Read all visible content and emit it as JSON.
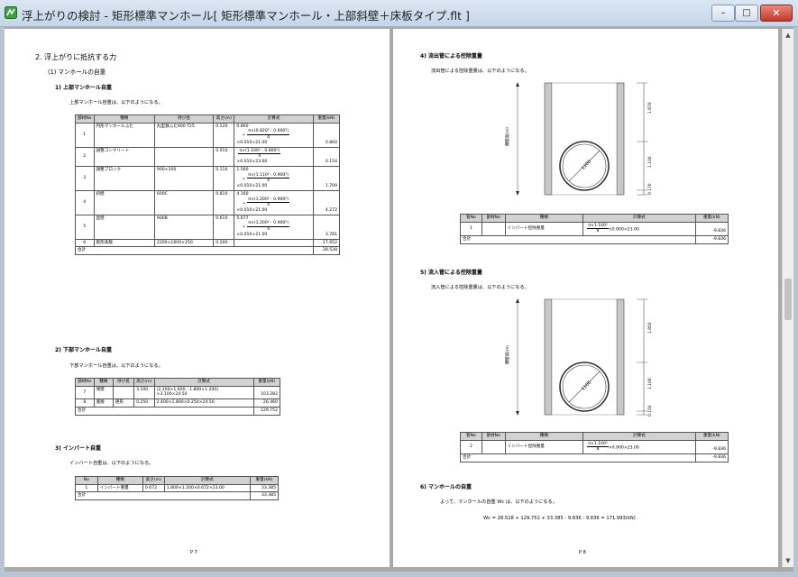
{
  "window": {
    "title": "浮上がりの検討 - 矩形標準マンホール[ 矩形標準マンホール・上部斜壁＋床板タイプ.flt ]",
    "min_label": "–",
    "max_label": "□",
    "close_label": "✕"
  },
  "left": {
    "section": "2. 浮上がりに抵抗する力",
    "sub1": "(1) マンホールの自重",
    "t1": "1) 上部マンホール自重",
    "t1_desc": "上部マンホール自重は、以下のようになる。",
    "table1": {
      "headers": [
        "部材No",
        "種類",
        "呼び名",
        "高さ(m)",
        "計算式",
        "重量(kN)"
      ],
      "rows": [
        {
          "no": "1",
          "kind": "円形マンホールふた",
          "name": "丸型鉄ふた600 T25",
          "h": "0.120",
          "l1": "0.800",
          "num": "π×(0.820² - 0.600²)",
          "den": "4",
          "l3": "×0.010×21.00",
          "w": "0.860"
        },
        {
          "no": "2",
          "kind": "調整コンクリート",
          "name": "",
          "h": "0.010",
          "l1": "",
          "num": "π×(1.100² - 0.800²)",
          "den": "4",
          "l3": "×0.010×23.00",
          "w": "0.154"
        },
        {
          "no": "3",
          "kind": "調整ブロック",
          "name": "900×100",
          "h": "0.110",
          "l1": "1.560",
          "num": "π×(1.110² - 0.900²)",
          "den": "4",
          "l3": "×0.010×21.00",
          "w": "1.709"
        },
        {
          "no": "4",
          "kind": "斜壁",
          "name": "600C",
          "h": "0.810",
          "l1": "4.160",
          "num": "π×(1.200² - 0.900²)",
          "den": "4",
          "l3": "×0.010×21.00",
          "w": "4.272"
        },
        {
          "no": "5",
          "kind": "直壁",
          "name": "900B",
          "h": "0.610",
          "l1": "5.677",
          "num": "π×(1.200² - 0.900²)",
          "den": "4",
          "l3": "×0.010×21.00",
          "w": "3.781"
        },
        {
          "no": "6",
          "kind": "矩形床版",
          "name": "2200×1600×250",
          "h": "0.200",
          "l1": "",
          "num": "",
          "den": "",
          "l3": "",
          "w": "17.652"
        }
      ],
      "total_label": "合計",
      "total": "28.528"
    },
    "t2": "2) 下部マンホール自重",
    "t2_desc": "下部マンホール自重は、以下のようになる。",
    "table2": {
      "headers": [
        "部材No",
        "種類",
        "呼び名",
        "高さ(m)",
        "計算式",
        "重量(kN)"
      ],
      "rows": [
        {
          "no": "7",
          "kind": "側壁",
          "name": "",
          "h": "3.100",
          "f1": "(2.200×1.600 - 1.800×1.200)",
          "f2": "×3.100×24.50",
          "w": "103.282"
        },
        {
          "no": "8",
          "kind": "底版",
          "name": "矩形",
          "h": "0.250",
          "f1": "2.400×1.800×0.250×24.50",
          "f2": "",
          "w": "26.460"
        }
      ],
      "total_label": "合計",
      "total": "129.752"
    },
    "t3": "3) インバート自重",
    "t3_desc": "インバート自重は、以下のようになる。",
    "table3": {
      "headers": [
        "No",
        "種類",
        "高さ(m)",
        "計算式",
        "重量(kN)"
      ],
      "rows": [
        {
          "no": "1",
          "kind": "インバート重量",
          "h": "0.672",
          "f": "1.800×1.200×0.672×23.00",
          "w": "33.385"
        }
      ],
      "total_label": "合計",
      "total": "33.385"
    },
    "page_no": "P 7"
  },
  "right": {
    "t4": "4) 流出管による控除重量",
    "t4_desc": "流出管による控除重量は、以下のようになる。",
    "fig1": {
      "wall_label": "側壁高(m)",
      "dims": [
        "1.670",
        "1.100",
        "0.170"
      ],
      "circle": "1100"
    },
    "table4": {
      "headers": [
        "管No",
        "部材No",
        "種類",
        "計算式",
        "重量(kN)"
      ],
      "row": {
        "pipe": "1",
        "no": "",
        "kind": "インバート控除重量",
        "num": "π×1.100²",
        "den": "8",
        "rest": "×0.900×23.00",
        "w": "-9.836"
      },
      "total_label": "合計",
      "total": "-9.836"
    },
    "t5": "5) 流入管による控除重量",
    "t5_desc": "流入管による控除重量は、以下のようになる。",
    "fig2": {
      "wall_label": "側壁高(m)",
      "dims": [
        "1.850",
        "1.100",
        "0.150"
      ],
      "circle": "1100"
    },
    "table5": {
      "headers": [
        "管No",
        "部材No",
        "種類",
        "計算式",
        "重量(kN)"
      ],
      "row": {
        "pipe": "2",
        "no": "",
        "kind": "インバート控除重量",
        "num": "π×1.100²",
        "den": "8",
        "rest": "×0.900×23.00",
        "w": "-9.836"
      },
      "total_label": "合計",
      "total": "-9.836"
    },
    "t6": "6) マンホールの自重",
    "t6_desc": "よって、マンホールの自重 Wc は、以下のようになる。",
    "t6_eq": "Wc = 28.528 + 129.752 + 33.385 - 9.836 - 9.836 = 171.993(kN)",
    "page_no": "P 8"
  },
  "colors": {
    "title_bar": "#c5d5e8",
    "close_button": "#c2392a",
    "header_cell": "#d2d2d2",
    "viewer_bg": "#a9a9a9"
  }
}
